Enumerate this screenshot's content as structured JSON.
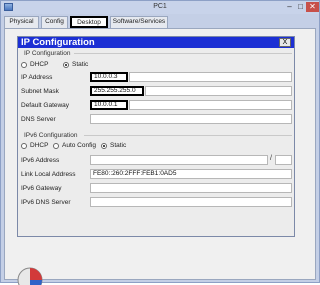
{
  "window": {
    "title": "PC1"
  },
  "tabs": [
    {
      "label": "Physical"
    },
    {
      "label": "Config"
    },
    {
      "label": "Desktop"
    },
    {
      "label": "Software/Services"
    }
  ],
  "dialog": {
    "title": "IP Configuration",
    "close": "X",
    "ipv4": {
      "section": "IP Configuration",
      "dhcp_label": "DHCP",
      "static_label": "Static",
      "mode": "Static",
      "fields": {
        "ip_address": {
          "label": "IP Address",
          "value": "10.0.0.3"
        },
        "subnet_mask": {
          "label": "Subnet Mask",
          "value": "255.255.255.0"
        },
        "default_gateway": {
          "label": "Default Gateway",
          "value": "10.0.0.1"
        },
        "dns_server": {
          "label": "DNS Server",
          "value": ""
        }
      }
    },
    "ipv6": {
      "section": "IPv6 Configuration",
      "dhcp_label": "DHCP",
      "auto_label": "Auto Config",
      "static_label": "Static",
      "mode": "Static",
      "fields": {
        "address": {
          "label": "IPv6 Address",
          "value": "",
          "prefix_sep": "/"
        },
        "link_local": {
          "label": "Link Local Address",
          "value": "FE80::260:2FFF:FEB1:0AD5"
        },
        "gateway": {
          "label": "IPv6 Gateway",
          "value": ""
        },
        "dns": {
          "label": "IPv6 DNS Server",
          "value": ""
        }
      }
    }
  },
  "colors": {
    "dialog_header": "#1c2fd4",
    "highlight_border": "#000000"
  }
}
